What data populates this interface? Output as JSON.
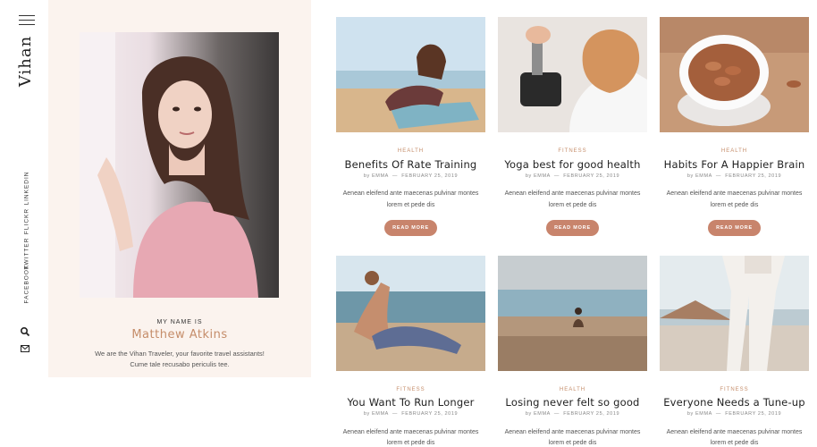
{
  "brand": {
    "name": "Vihan"
  },
  "socials": [
    {
      "label": "LINKEDIN"
    },
    {
      "label": "FLICKR"
    },
    {
      "label": "TWITTER"
    },
    {
      "label": "FACEBOOK"
    }
  ],
  "profile": {
    "label": "MY NAME IS",
    "name": "Matthew Atkins",
    "bio_line1": "We are the Vihan Traveler, your favorite travel assistants!",
    "bio_line2": "Cume tale recusabo periculis tee."
  },
  "posts": [
    {
      "category": "HEALTH",
      "title": "Benefits Of Rate Training",
      "author": "EMMA",
      "date": "FEBRUARY 25, 2019",
      "excerpt1": "Aenean eleifend ante maecenas pulvinar montes",
      "excerpt2": "lorem et pede dis",
      "button": "READ MORE"
    },
    {
      "category": "FITNESS",
      "title": "Yoga best for good health",
      "author": "EMMA",
      "date": "FEBRUARY 25, 2019",
      "excerpt1": "Aenean eleifend ante maecenas pulvinar montes",
      "excerpt2": "lorem et pede dis",
      "button": "READ MORE"
    },
    {
      "category": "HEALTH",
      "title": "Habits For A Happier Brain",
      "author": "EMMA",
      "date": "FEBRUARY 25, 2019",
      "excerpt1": "Aenean eleifend ante maecenas pulvinar montes",
      "excerpt2": "lorem et pede dis",
      "button": "READ MORE"
    },
    {
      "category": "FITNESS",
      "title": "You Want To Run Longer",
      "author": "EMMA",
      "date": "FEBRUARY 25, 2019",
      "excerpt1": "Aenean eleifend ante maecenas pulvinar montes",
      "excerpt2": "lorem et pede dis"
    },
    {
      "category": "HEALTH",
      "title": "Losing never felt so good",
      "author": "EMMA",
      "date": "FEBRUARY 25, 2019",
      "excerpt1": "Aenean eleifend ante maecenas pulvinar montes",
      "excerpt2": "lorem et pede dis"
    },
    {
      "category": "FITNESS",
      "title": "Everyone Needs a Tune-up",
      "author": "EMMA",
      "date": "FEBRUARY 25, 2019",
      "excerpt1": "Aenean eleifend ante maecenas pulvinar montes",
      "excerpt2": "lorem et pede dis"
    }
  ],
  "meta_prefix": "by",
  "icons": {
    "menu": "hamburger-menu-icon",
    "search": "search-icon",
    "mail": "mail-icon"
  },
  "colors": {
    "accent": "#c58d6a",
    "button": "#c8846c",
    "panel": "#fbf3ee"
  }
}
